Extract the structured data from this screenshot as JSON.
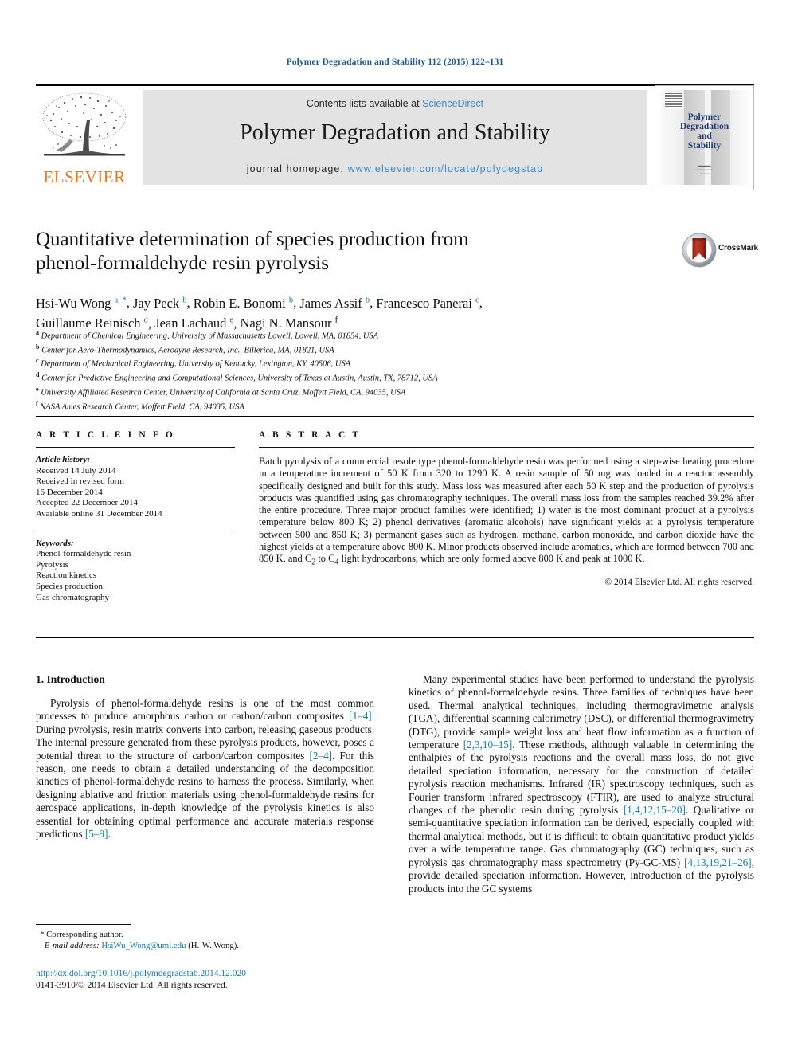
{
  "running_head": "Polymer Degradation and Stability 112 (2015) 122–131",
  "masthead": {
    "publisher_name": "ELSEVIER",
    "contents_prefix": "Contents lists available at ",
    "contents_link": "ScienceDirect",
    "journal_name": "Polymer Degradation and Stability",
    "homepage_prefix": "journal homepage: ",
    "homepage_link": "www.elsevier.com/locate/polydegstab",
    "cover_title": "Polymer\nDegradation\nand\nStability",
    "cover_title_lines": [
      "Polymer",
      "Degradation",
      "and",
      "Stability"
    ]
  },
  "article": {
    "title_line1": "Quantitative determination of species production from",
    "title_line2": "phenol-formaldehyde resin pyrolysis",
    "authors_line1_html": "Hsi-Wu Wong, Jay Peck, Robin E. Bonomi, James Assif, Francesco Panerai,",
    "authors_line2_html": "Guillaume Reinisch, Jean Lachaud, Nagi N. Mansour",
    "crossmark_label": "CrossMark",
    "affiliations": [
      {
        "mark": "a",
        "text": "Department of Chemical Engineering, University of Massachusetts Lowell, Lowell, MA, 01854, USA"
      },
      {
        "mark": "b",
        "text": "Center for Aero-Thermodynamics, Aerodyne Research, Inc., Billerica, MA, 01821, USA"
      },
      {
        "mark": "c",
        "text": "Department of Mechanical Engineering, University of Kentucky, Lexington, KY, 40506, USA"
      },
      {
        "mark": "d",
        "text": "Center for Predictive Engineering and Computational Sciences, University of Texas at Austin, Austin, TX, 78712, USA"
      },
      {
        "mark": "e",
        "text": "University Affiliated Research Center, University of California at Santa Cruz, Moffett Field, CA, 94035, USA"
      },
      {
        "mark": "f",
        "text": "NASA Ames Research Center, Moffett Field, CA, 94035, USA"
      }
    ]
  },
  "article_info": {
    "heading": "A R T I C L E   I N F O",
    "history_label": "Article history:",
    "history": [
      "Received 14 July 2014",
      "Received in revised form",
      "16 December 2014",
      "Accepted 22 December 2014",
      "Available online 31 December 2014"
    ],
    "keywords_label": "Keywords:",
    "keywords": [
      "Phenol-formaldehyde resin",
      "Pyrolysis",
      "Reaction kinetics",
      "Species production",
      "Gas chromatography"
    ]
  },
  "abstract": {
    "heading": "A B S T R A C T",
    "text": "Batch pyrolysis of a commercial resole type phenol-formaldehyde resin was performed using a step-wise heating procedure in a temperature increment of 50 K from 320 to 1290 K. A resin sample of 50 mg was loaded in a reactor assembly specifically designed and built for this study. Mass loss was measured after each 50 K step and the production of pyrolysis products was quantified using gas chromatography techniques. The overall mass loss from the samples reached 39.2% after the entire procedure. Three major product families were identified; 1) water is the most dominant product at a pyrolysis temperature below 800 K; 2) phenol derivatives (aromatic alcohols) have significant yields at a pyrolysis temperature between 500 and 850 K; 3) permanent gases such as hydrogen, methane, carbon monoxide, and carbon dioxide have the highest yields at a temperature above 800 K. Minor products observed include aromatics, which are formed between 700 and 850 K, and C2 to C4 light hydrocarbons, which are only formed above 800 K and peak at 1000 K.",
    "copyright": "© 2014 Elsevier Ltd. All rights reserved."
  },
  "body": {
    "section_title": "1. Introduction",
    "left_paragraph_parts": [
      "Pyrolysis of phenol-formaldehyde resins is one of the most common processes to produce amorphous carbon or carbon/carbon composites ",
      "[1–4]",
      ". During pyrolysis, resin matrix converts into carbon, releasing gaseous products. The internal pressure generated from these pyrolysis products, however, poses a potential threat to the structure of carbon/carbon composites ",
      "[2–4]",
      ". For this reason, one needs to obtain a detailed understanding of the decomposition kinetics of phenol-formaldehyde resins to harness the process. Similarly, when designing ablative and friction materials using phenol-formaldehyde resins for aerospace applications, in-depth knowledge of the pyrolysis kinetics is also essential for obtaining optimal performance and accurate materials response predictions ",
      "[5–9]",
      "."
    ],
    "right_paragraph_parts": [
      "Many experimental studies have been performed to understand the pyrolysis kinetics of phenol-formaldehyde resins. Three families of techniques have been used. Thermal analytical techniques, including thermogravimetric analysis (TGA), differential scanning calorimetry (DSC), or differential thermogravimetry (DTG), provide sample weight loss and heat flow information as a function of temperature ",
      "[2,3,10–15]",
      ". These methods, although valuable in determining the enthalpies of the pyrolysis reactions and the overall mass loss, do not give detailed speciation information, necessary for the construction of detailed pyrolysis reaction mechanisms. Infrared (IR) spectroscopy techniques, such as Fourier transform infrared spectroscopy (FTIR), are used to analyze structural changes of the phenolic resin during pyrolysis ",
      "[1,4,12,15–20]",
      ". Qualitative or semi-quantitative speciation information can be derived, especially coupled with thermal analytical methods, but it is difficult to obtain quantitative product yields over a wide temperature range. Gas chromatography (GC) techniques, such as pyrolysis gas chromatography mass spectrometry (Py-GC-MS) ",
      "[4,13,19,21–26]",
      ", provide detailed speciation information. However, introduction of the pyrolysis products into the GC systems"
    ]
  },
  "footer": {
    "corresponding_star": "*",
    "corresponding_label": "Corresponding author.",
    "email_label": "E-mail address:",
    "email": "HsiWu_Wong@uml.edu",
    "email_suffix": "(H.-W. Wong).",
    "doi": "http://dx.doi.org/10.1016/j.polymdegradstab.2014.12.020",
    "issn_line": "0141-3910/© 2014 Elsevier Ltd. All rights reserved."
  },
  "colors": {
    "link_blue": "#0b7fab",
    "head_blue": "#1a5b8f",
    "sd_blue": "#3b8ccc",
    "elsevier_orange": "#E87722",
    "cover_navy": "#1e3c78",
    "band_gray": "#e3e3e3"
  }
}
